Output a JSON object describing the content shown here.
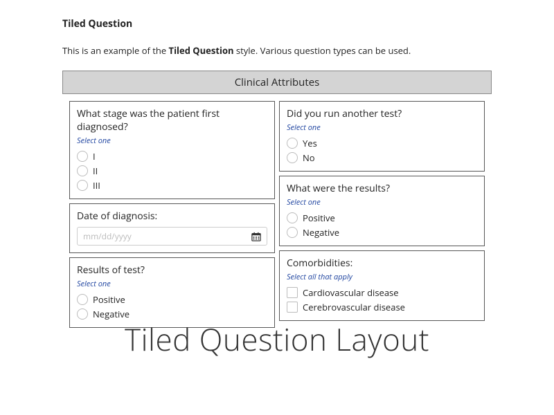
{
  "heading": "Tiled Question",
  "intro_prefix": "This is an example of the ",
  "intro_bold": "Tiled Question",
  "intro_suffix": " style. Various question types can be used.",
  "section_title": "Clinical Attributes",
  "left": {
    "q1": {
      "label": "What stage was the patient first diagnosed?",
      "hint": "Select one",
      "options": [
        "I",
        "II",
        "III"
      ]
    },
    "q2": {
      "label": "Date of diagnosis:",
      "placeholder": "mm/dd/yyyy"
    },
    "q3": {
      "label": "Results of test?",
      "hint": "Select one",
      "options": [
        "Positive",
        "Negative"
      ]
    }
  },
  "right": {
    "q1": {
      "label": "Did you run another test?",
      "hint": "Select one",
      "options": [
        "Yes",
        "No"
      ]
    },
    "q2": {
      "label": "What were the results?",
      "hint": "Select one",
      "options": [
        "Positive",
        "Negative"
      ]
    },
    "q3": {
      "label": "Comorbidities:",
      "hint": "Select all that apply",
      "options": [
        "Cardiovascular disease",
        "Cerebrovascular disease"
      ]
    }
  },
  "caption": "Tiled Question Layout"
}
